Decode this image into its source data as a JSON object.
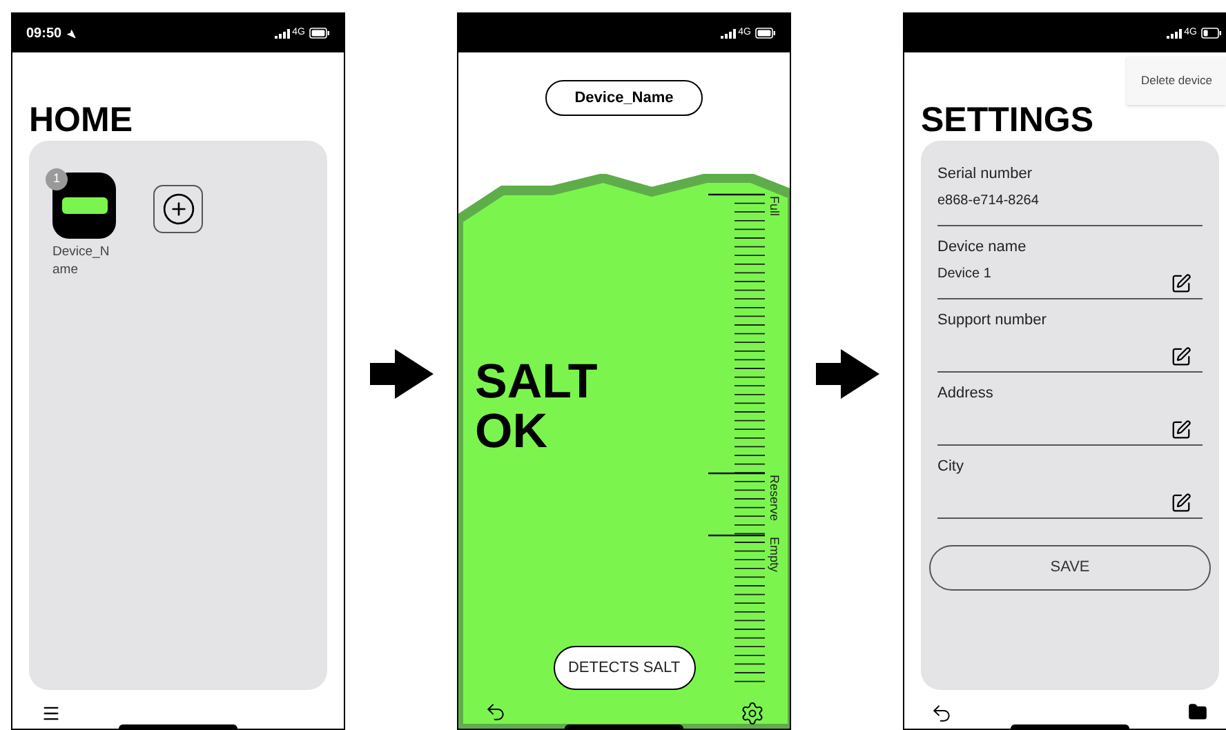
{
  "screens": [
    {
      "kind": "home",
      "status_bar": {
        "time": "09:50",
        "location": true,
        "network": "4G",
        "battery_low": false
      },
      "title": "HOME",
      "devices": [
        {
          "name": "Device_Name",
          "badge": "1"
        }
      ]
    },
    {
      "kind": "salt",
      "status_bar": {
        "location": false,
        "network": "4G",
        "battery_low": false
      },
      "device_button": "Device_Name",
      "status_text": "SALT OK",
      "scale_labels": [
        "Full",
        "Reserve",
        "Empty"
      ],
      "detect_button": "DETECTS SALT"
    },
    {
      "kind": "settings",
      "status_bar": {
        "location": false,
        "network": "4G",
        "battery_low": true
      },
      "menu": [
        "Delete device"
      ],
      "title": "SETTINGS",
      "fields": [
        {
          "label": "Serial number",
          "value": "e868-e714-8264",
          "editable": false
        },
        {
          "label": "Device name",
          "value": "Device 1",
          "editable": true
        },
        {
          "label": "Support number",
          "editable": true
        },
        {
          "label": "Address",
          "editable": true
        },
        {
          "label": "City",
          "editable": true
        }
      ],
      "save_button": "SAVE"
    }
  ]
}
